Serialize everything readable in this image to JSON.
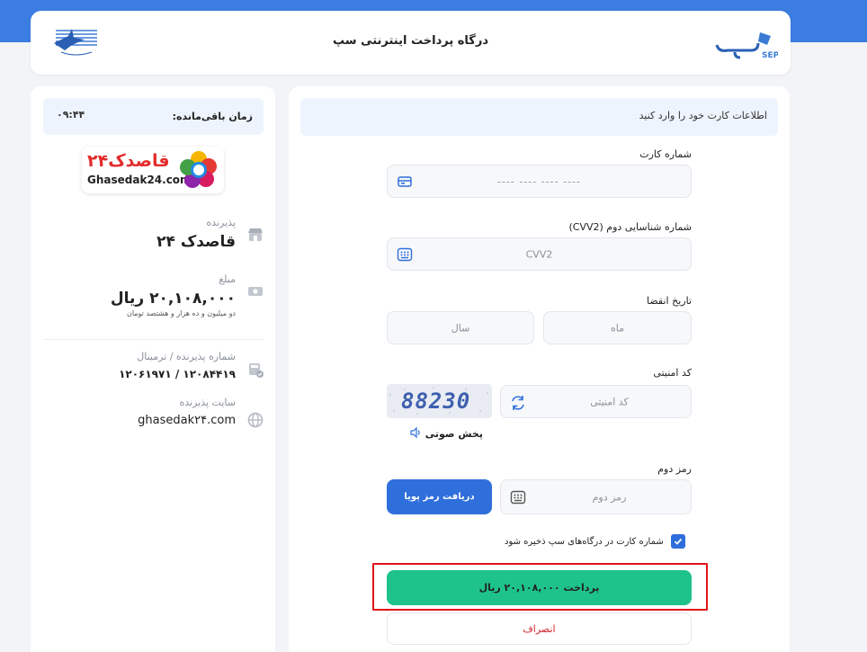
{
  "header": {
    "title": "درگاه پرداخت اینترنتی سپ",
    "sep_logo_text": "SEP"
  },
  "form": {
    "hint": "اطلاعات کارت خود را وارد کنید",
    "card_number": {
      "label": "شماره کارت",
      "placeholder": "---- ---- ---- ----"
    },
    "cvv2": {
      "label": "شماره شناسایی دوم (CVV2)",
      "placeholder": "CVV2"
    },
    "expiry": {
      "label": "تاریخ انقضا",
      "month_placeholder": "ماه",
      "year_placeholder": "سال"
    },
    "captcha": {
      "label": "کد امنیتی",
      "placeholder": "کد امنیتی",
      "image_text": "88230",
      "audio_label": "پخش صوتی"
    },
    "otp": {
      "label": "رمز دوم",
      "placeholder": "رمز دوم",
      "button_label": "دریافت رمز پویا"
    },
    "save_card": {
      "label": "شماره کارت در درگاه‌های سپ ذخیره شود",
      "checked": true
    },
    "pay_button": "پرداخت ۲۰,۱۰۸,۰۰۰ ریال",
    "cancel_button": "انصراف"
  },
  "info": {
    "timer_label": "زمان باقی‌مانده:",
    "timer_value": "۰۹:۴۴",
    "merchant_logo_fa": "قاصدک۲۴",
    "merchant_logo_en": "Ghasedak24.com",
    "merchant": {
      "caption": "پذیرنده",
      "value": "قاصدک ۲۴"
    },
    "amount": {
      "caption": "مبلغ",
      "value": "۲۰,۱۰۸,۰۰۰ ریال",
      "words": "دو میلیون و ده هزار و هشتصد تومان"
    },
    "terminal": {
      "caption": "شماره پذیرنده / ترمینال",
      "value": "۱۲۰۸۴۴۱۹ / ۱۲۰۶۱۹۷۱"
    },
    "site": {
      "caption": "سایت پذیرنده",
      "value": "ghasedak۲۴.com"
    }
  },
  "colors": {
    "primary": "#2f6fdb",
    "success": "#1ec38b",
    "danger": "#d6232d",
    "highlight": "#e0131d",
    "top_band": "#3b7de0"
  }
}
